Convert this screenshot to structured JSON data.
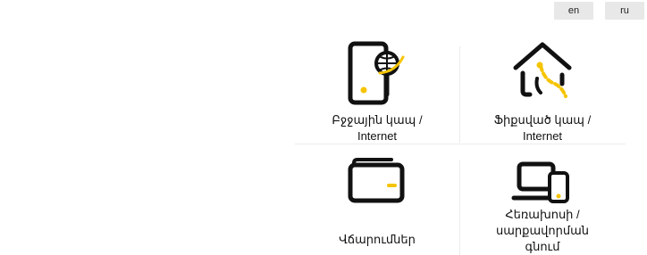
{
  "languages": {
    "en": "en",
    "ru": "ru"
  },
  "colors": {
    "accent": "#f5c400",
    "icon": "#111111",
    "divider": "#ececec",
    "lang_bg": "#e8e8e8"
  },
  "tiles": [
    {
      "icon": "mobile-phone-globe-icon",
      "label": "Բջջային կապ /\nInternet"
    },
    {
      "icon": "home-router-icon",
      "label": "Ֆիքսված կապ /\nInternet"
    },
    {
      "icon": "wallet-icon",
      "label": "Վճարումներ"
    },
    {
      "icon": "devices-icon",
      "label": "Հեռախոսի /\nսարքավորման\nգնում"
    }
  ]
}
